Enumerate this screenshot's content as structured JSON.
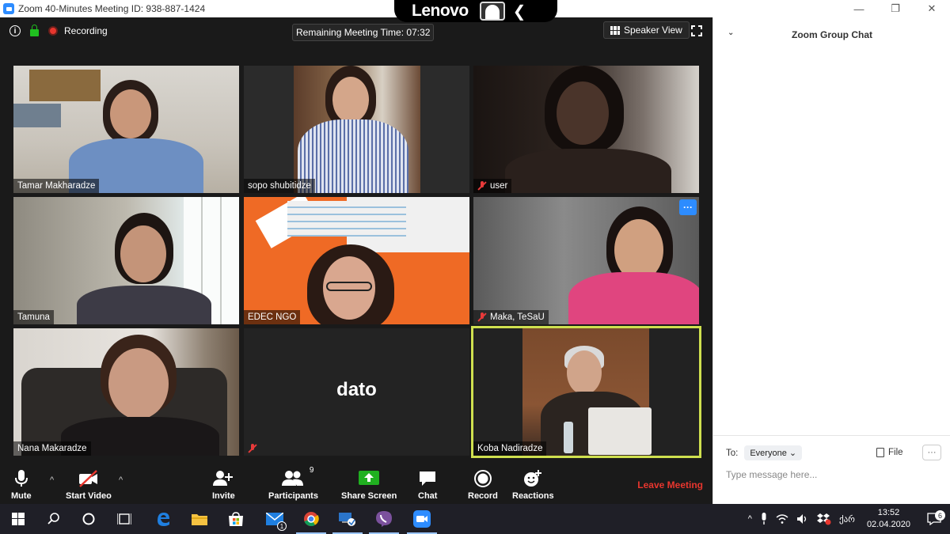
{
  "window": {
    "title": "Zoom 40-Minutes Meeting ID: 938-887-1424",
    "controls": [
      "minimize",
      "restore",
      "close"
    ]
  },
  "overlay": {
    "brand": "Lenovo"
  },
  "meeting_header": {
    "recording_label": "Recording",
    "remaining_time": "Remaining Meeting Time: 07:32",
    "speaker_view_label": "Speaker View"
  },
  "participants": [
    {
      "name": "Tamar Makharadze",
      "muted": false
    },
    {
      "name": "sopo shubitidze",
      "muted": false
    },
    {
      "name": "user",
      "muted": true
    },
    {
      "name": "Tamuna",
      "muted": false
    },
    {
      "name": "EDEC NGO",
      "muted": false
    },
    {
      "name": "Maka, TeSaU",
      "muted": true
    },
    {
      "name": "Nana Makaradze",
      "muted": false
    },
    {
      "name": "",
      "muted": true,
      "placeholder_name": "dato"
    },
    {
      "name": "Koba Nadiradze",
      "muted": false,
      "active_speaker": true
    }
  ],
  "toolbar": {
    "mute_label": "Mute",
    "start_video_label": "Start Video",
    "invite_label": "Invite",
    "participants_label": "Participants",
    "participants_count": "9",
    "share_screen_label": "Share Screen",
    "chat_label": "Chat",
    "record_label": "Record",
    "reactions_label": "Reactions",
    "leave_label": "Leave Meeting"
  },
  "chat": {
    "title": "Zoom Group Chat",
    "to_label": "To:",
    "recipient": "Everyone",
    "file_label": "File",
    "more_label": "···",
    "input_placeholder": "Type message here..."
  },
  "taskbar": {
    "apps": [
      "windows-start",
      "search",
      "cortana",
      "task-view",
      "edge",
      "file-explorer",
      "store",
      "mail",
      "chrome",
      "network-app",
      "viber",
      "zoom"
    ],
    "mail_badge": "1",
    "language": "ქარ",
    "time": "13:52",
    "date": "02.04.2020",
    "notifications_count": "6"
  },
  "colors": {
    "accent_blue": "#2d8cff",
    "leave_red": "#e8362e",
    "active_speaker_border": "#cfe04f",
    "share_green": "#20b020"
  }
}
